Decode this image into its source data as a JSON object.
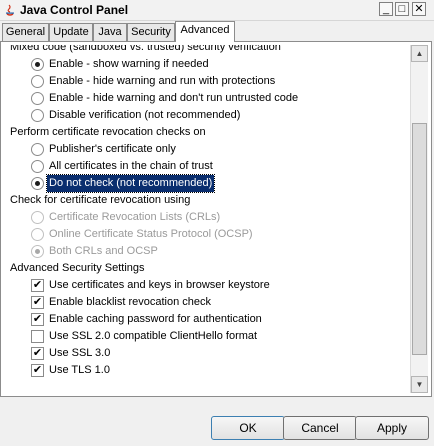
{
  "window": {
    "title": "Java Control Panel",
    "icon": "java-icon"
  },
  "tabs": [
    {
      "label": "General",
      "active": false
    },
    {
      "label": "Update",
      "active": false
    },
    {
      "label": "Java",
      "active": false
    },
    {
      "label": "Security",
      "active": false
    },
    {
      "label": "Advanced",
      "active": true
    }
  ],
  "settings": {
    "mixed_code": {
      "heading": "Mixed code (sandboxed vs. trusted) security verification",
      "options": [
        {
          "label": "Enable - show warning if needed",
          "checked": true
        },
        {
          "label": "Enable - hide warning and run with protections",
          "checked": false
        },
        {
          "label": "Enable - hide warning and don't run untrusted code",
          "checked": false
        },
        {
          "label": "Disable verification (not recommended)",
          "checked": false
        }
      ]
    },
    "revocation_checks": {
      "heading": "Perform certificate revocation checks on",
      "options": [
        {
          "label": "Publisher's certificate only",
          "checked": false
        },
        {
          "label": "All certificates in the chain of trust",
          "checked": false
        },
        {
          "label": "Do not check (not recommended)",
          "checked": true,
          "selected": true
        }
      ]
    },
    "revocation_using": {
      "heading": "Check for certificate revocation using",
      "options": [
        {
          "label": "Certificate Revocation Lists (CRLs)",
          "checked": false,
          "disabled": true
        },
        {
          "label": "Online Certificate Status Protocol (OCSP)",
          "checked": false,
          "disabled": true
        },
        {
          "label": "Both CRLs and OCSP",
          "checked": true,
          "disabled": true
        }
      ]
    },
    "advanced_security": {
      "heading": "Advanced Security Settings",
      "options": [
        {
          "label": "Use certificates and keys in browser keystore",
          "checked": true
        },
        {
          "label": "Enable blacklist revocation check",
          "checked": true
        },
        {
          "label": "Enable caching password for authentication",
          "checked": true
        },
        {
          "label": "Use SSL 2.0 compatible ClientHello format",
          "checked": false
        },
        {
          "label": "Use SSL 3.0",
          "checked": true
        },
        {
          "label": "Use TLS 1.0",
          "checked": true
        }
      ]
    }
  },
  "scroll": {
    "vertical_position": 0.72
  },
  "buttons": {
    "ok": "OK",
    "cancel": "Cancel",
    "apply": "Apply"
  }
}
